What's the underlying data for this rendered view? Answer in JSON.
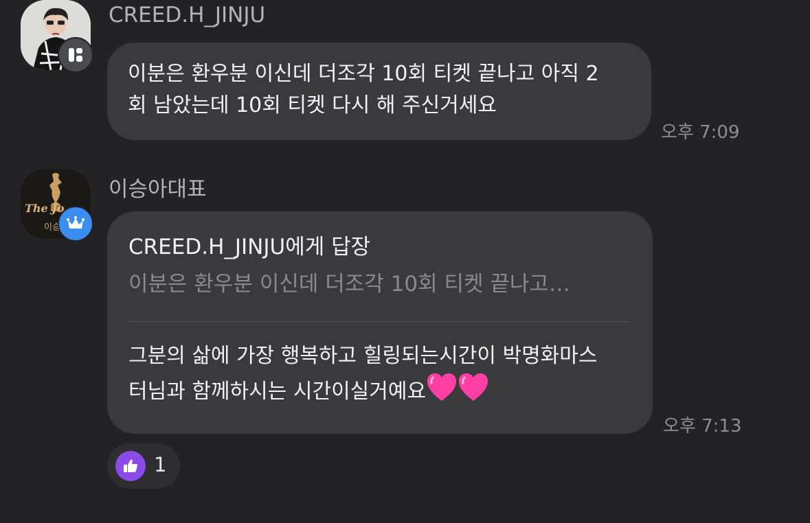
{
  "messages": [
    {
      "sender": "CREED.H_JINJU",
      "text_line1": "이분은 환우분  이신데 더조각 10회 티켓 끝나고 아직 2",
      "text_line2": "회 남았는데 10회 티켓 다시 해 주신거세요",
      "time": "오후 7:09",
      "avatar_badge_icon": "brand-app-icon"
    },
    {
      "sender": "이승아대표",
      "reply_to": "CREED.H_JINJU에게 답장",
      "quoted_text": "이분은 환우분  이신데 더조각 10회 티켓 끝나고…",
      "text_line1": "그분의 삶에 가장 행복하고 힐링되는시간이 박명화마스",
      "text_line2": "터님과 함께하시는 시간이실거예요",
      "emoji": [
        "pink-heart",
        "pink-heart"
      ],
      "time": "오후 7:13",
      "avatar_badge_icon": "crown-icon",
      "avatar_logo_text": "The Jo",
      "avatar_logo_sub": "이승"
    }
  ],
  "reactions": [
    {
      "icon": "thumbs-up-icon",
      "count": "1"
    }
  ],
  "colors": {
    "background": "#232224",
    "bubble": "#3a3a3d",
    "reaction_accent": "#8b4be8",
    "admin_badge": "#3a8ef2",
    "heart": "#ff3fa4"
  }
}
